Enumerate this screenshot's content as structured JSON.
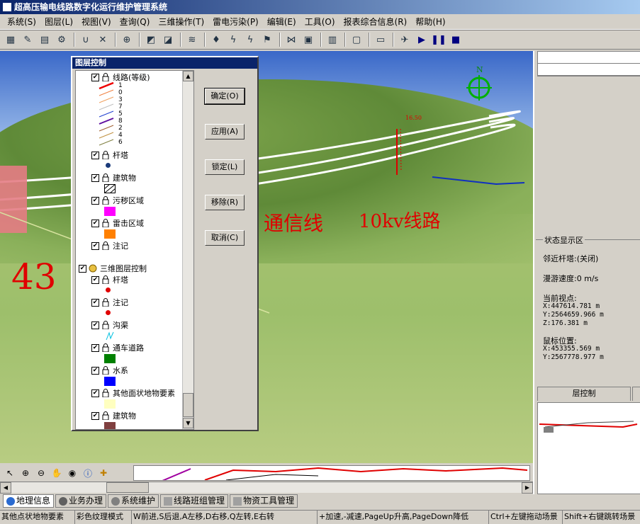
{
  "window": {
    "title": "超高压输电线路数字化运行维护管理系统"
  },
  "menu": [
    "系统(S)",
    "图层(L)",
    "视图(V)",
    "查询(Q)",
    "三维操作(T)",
    "雷电污染(P)",
    "编辑(E)",
    "工具(O)",
    "报表综合信息(R)",
    "帮助(H)"
  ],
  "toolbar_icons": [
    "table-icon",
    "edit-icon",
    "calc-icon",
    "gear-icon",
    "magnet-icon",
    "tools-icon",
    "layers-icon",
    "chart-icon",
    "note-icon",
    "stack-icon",
    "paint-icon",
    "lightning-icon",
    "lightning-alt-icon",
    "flag-icon",
    "pattern-icon",
    "image-icon",
    "box-icon",
    "monitor-icon",
    "train-icon",
    "plane-icon",
    "play-icon",
    "pause-icon",
    "stop-icon"
  ],
  "scene": {
    "labels": {
      "comm_line": "通信线",
      "line_10kv": "10kv线路",
      "tower_number": "43",
      "tower_small": "16.50"
    },
    "compass": "N"
  },
  "layer_dialog": {
    "title": "图层控制",
    "groups": [
      {
        "name": "线路(等级)",
        "legend": [
          "1",
          "0",
          "3",
          "7",
          "5",
          "8",
          "2",
          "4",
          "6"
        ]
      },
      {
        "name": "杆塔"
      },
      {
        "name": "建筑物"
      },
      {
        "name": "污秽区域"
      },
      {
        "name": "雷击区域"
      },
      {
        "name": "注记"
      }
    ],
    "threed_group": "三维图层控制",
    "threed_items": [
      "杆塔",
      "注记",
      "沟渠",
      "通车道路",
      "水系",
      "其他面状地物要素",
      "建筑物"
    ],
    "buttons": {
      "ok": "确定(O)",
      "apply": "应用(A)",
      "lock": "锁定(L)",
      "remove": "移除(R)",
      "cancel": "取消(C)"
    }
  },
  "status_panel": {
    "title": "状态显示区",
    "nearby_tower_label": "邻近杆塔:",
    "nearby_tower_value": "(关闭)",
    "speed_label": "漫游速度:",
    "speed_value": "0 m/s",
    "viewpoint_label": "当前视点:",
    "viewpoint_x": "X:447614.781 m",
    "viewpoint_y": "Y:2564659.966 m",
    "viewpoint_z": "Z:176.381 m",
    "mouse_label": "鼠标位置:",
    "mouse_x": "X:453355.569 m",
    "mouse_y": "Y:2567778.977 m",
    "tabs": [
      "层控制",
      ""
    ]
  },
  "module_tabs": [
    "地理信息",
    "业务办理",
    "系统维护",
    "线路班组管理",
    "物资工具管理"
  ],
  "statusline": [
    "其他点状地物要素",
    "彩色纹理模式",
    "W前进,S后退,A左移,D右移,Q左转,E右转",
    "+加速,-减速,PageUp升高,PageDown降低",
    "Ctrl+左键拖动场景",
    "Shift+右键跳转场景"
  ],
  "colors": {
    "title_bg": "#0a246a",
    "scene_label": "#e00000",
    "ui_face": "#d4d0c8"
  }
}
